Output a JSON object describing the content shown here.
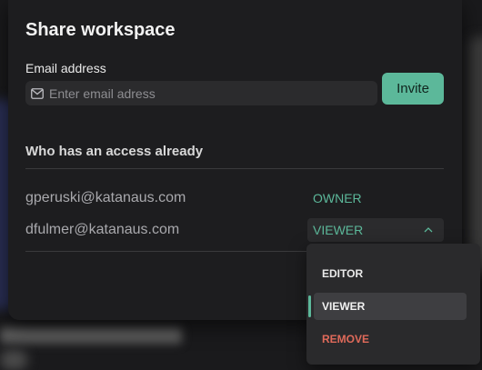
{
  "modal": {
    "title": "Share workspace",
    "email_label": "Email address",
    "email_placeholder": "Enter email adress",
    "invite_label": "Invite",
    "section_title": "Who has an access already"
  },
  "members": [
    {
      "email": "gperuski@katanaus.com",
      "role": "OWNER"
    },
    {
      "email": "dfulmer@katanaus.com",
      "role": "VIEWER"
    }
  ],
  "role_dropdown": {
    "options": [
      "EDITOR",
      "VIEWER",
      "REMOVE"
    ],
    "selected": "VIEWER"
  },
  "colors": {
    "accent": "#5cb89a",
    "danger": "#e06a5a",
    "modal_bg": "#1d1d1f"
  },
  "icons": {
    "email_field": "mail-icon",
    "role_select": "chevron-up-icon"
  }
}
